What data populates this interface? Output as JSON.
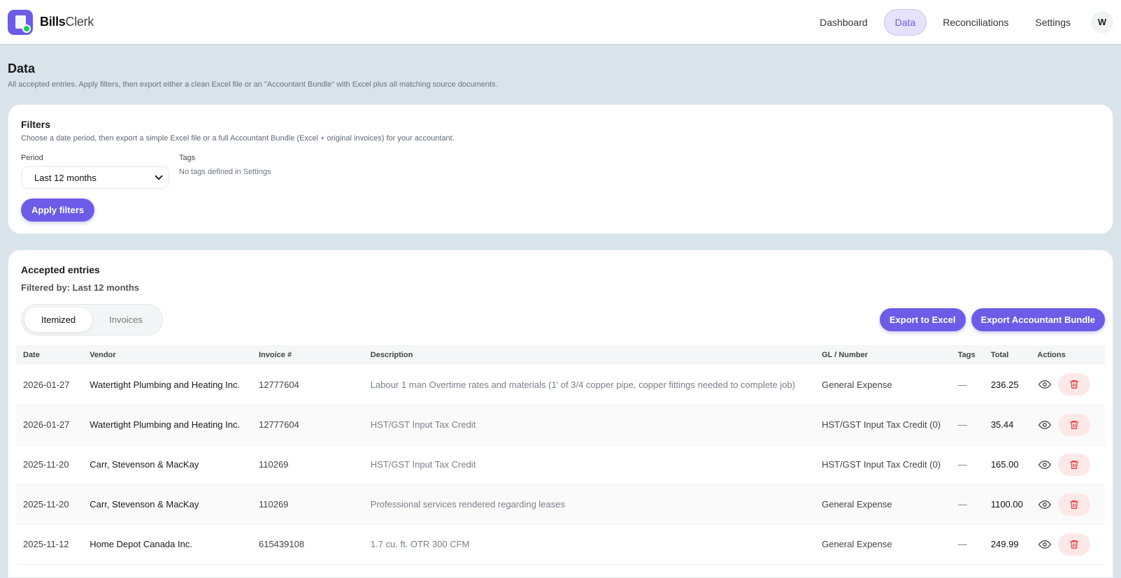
{
  "brand": {
    "bold": "Bills",
    "light": "Clerk"
  },
  "nav": {
    "items": [
      {
        "label": "Dashboard",
        "active": false
      },
      {
        "label": "Data",
        "active": true
      },
      {
        "label": "Reconciliations",
        "active": false
      },
      {
        "label": "Settings",
        "active": false
      }
    ],
    "avatar": "W"
  },
  "page": {
    "title": "Data",
    "subtitle": "All accepted entries. Apply filters, then export either a clean Excel file or an \"Accountant Bundle\" with Excel plus all matching source documents."
  },
  "filters": {
    "title": "Filters",
    "subtitle": "Choose a date period, then export a simple Excel file or a full Accountant Bundle (Excel + original invoices) for your accountant.",
    "period_label": "Period",
    "period_value": "Last 12 months",
    "tags_label": "Tags",
    "tags_empty": "No tags defined in Settings",
    "apply_label": "Apply filters"
  },
  "entries": {
    "title": "Accepted entries",
    "filtered_by": "Filtered by: Last 12 months",
    "tabs": [
      {
        "label": "Itemized",
        "active": true
      },
      {
        "label": "Invoices",
        "active": false
      }
    ],
    "export_excel": "Export to Excel",
    "export_bundle": "Export Accountant Bundle",
    "columns": [
      "Date",
      "Vendor",
      "Invoice #",
      "Description",
      "GL / Number",
      "Tags",
      "Total",
      "Actions"
    ],
    "rows": [
      {
        "date": "2026-01-27",
        "vendor": "Watertight Plumbing and Heating Inc.",
        "invoice": "12777604",
        "description": "Labour 1 man Overtime rates and materials (1' of 3/4 copper pipe, copper fittings needed to complete job)",
        "gl": "General Expense",
        "tags": "—",
        "total": "236.25"
      },
      {
        "date": "2026-01-27",
        "vendor": "Watertight Plumbing and Heating Inc.",
        "invoice": "12777604",
        "description": "HST/GST Input Tax Credit",
        "gl": "HST/GST Input Tax Credit (0)",
        "tags": "—",
        "total": "35.44"
      },
      {
        "date": "2025-11-20",
        "vendor": "Carr, Stevenson & MacKay",
        "invoice": "110269",
        "description": "HST/GST Input Tax Credit",
        "gl": "HST/GST Input Tax Credit (0)",
        "tags": "—",
        "total": "165.00"
      },
      {
        "date": "2025-11-20",
        "vendor": "Carr, Stevenson & MacKay",
        "invoice": "110269",
        "description": "Professional services rendered regarding leases",
        "gl": "General Expense",
        "tags": "—",
        "total": "1100.00"
      },
      {
        "date": "2025-11-12",
        "vendor": "Home Depot Canada Inc.",
        "invoice": "615439108",
        "description": "1.7 cu. ft. OTR 300 CFM",
        "gl": "General Expense",
        "tags": "—",
        "total": "249.99"
      }
    ]
  },
  "colors": {
    "accent": "#6c5ce7",
    "success": "#22c55e",
    "danger": "#e5484d",
    "danger_bg": "#fde8e8"
  }
}
